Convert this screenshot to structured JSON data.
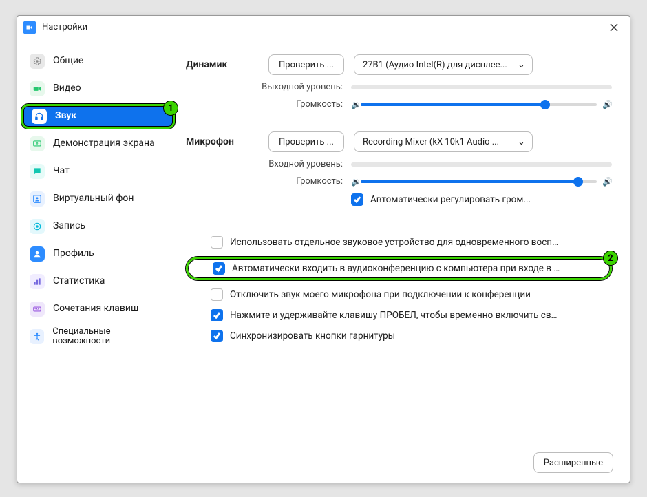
{
  "window": {
    "title": "Настройки"
  },
  "sidebar": {
    "items": [
      {
        "label": "Общие",
        "icon": "gear"
      },
      {
        "label": "Видео",
        "icon": "camera"
      },
      {
        "label": "Звук",
        "icon": "headphones",
        "active": true,
        "highlight_num": "1"
      },
      {
        "label": "Демонстрация экрана",
        "icon": "screen"
      },
      {
        "label": "Чат",
        "icon": "chat"
      },
      {
        "label": "Виртуальный фон",
        "icon": "vb"
      },
      {
        "label": "Запись",
        "icon": "record"
      },
      {
        "label": "Профиль",
        "icon": "profile"
      },
      {
        "label": "Статистика",
        "icon": "stats"
      },
      {
        "label": "Сочетания клавиш",
        "icon": "keyboard"
      },
      {
        "label": "Специальные возможности",
        "icon": "accessibility"
      }
    ]
  },
  "speaker": {
    "section_label": "Динамик",
    "test_btn": "Проверить ...",
    "device": "27B1 (Аудио Intel(R) для дисплее...",
    "output_level_label": "Выходной уровень:",
    "volume_label": "Громкость:",
    "volume_pct": 78
  },
  "mic": {
    "section_label": "Микрофон",
    "test_btn": "Проверить ...",
    "device": "Recording Mixer (kX 10k1 Audio ...",
    "input_level_label": "Входной уровень:",
    "volume_label": "Громкость:",
    "volume_pct": 92,
    "auto_adjust_label": "Автоматически регулировать гром..."
  },
  "options": {
    "separate_device": "Использовать отдельное звуковое устройство для одновременного воспро...",
    "auto_join": "Автоматически входить в аудиоконференцию с компьютера при входе в кон...",
    "auto_join_highlight_num": "2",
    "mute_mic": "Отключить звук моего микрофона при подключении к конференции",
    "push_to_talk": "Нажмите и удерживайте клавишу ПРОБЕЛ, чтобы временно включить свой з...",
    "sync_headset": "Синхронизировать кнопки гарнитуры"
  },
  "footer": {
    "advanced": "Расширенные"
  }
}
